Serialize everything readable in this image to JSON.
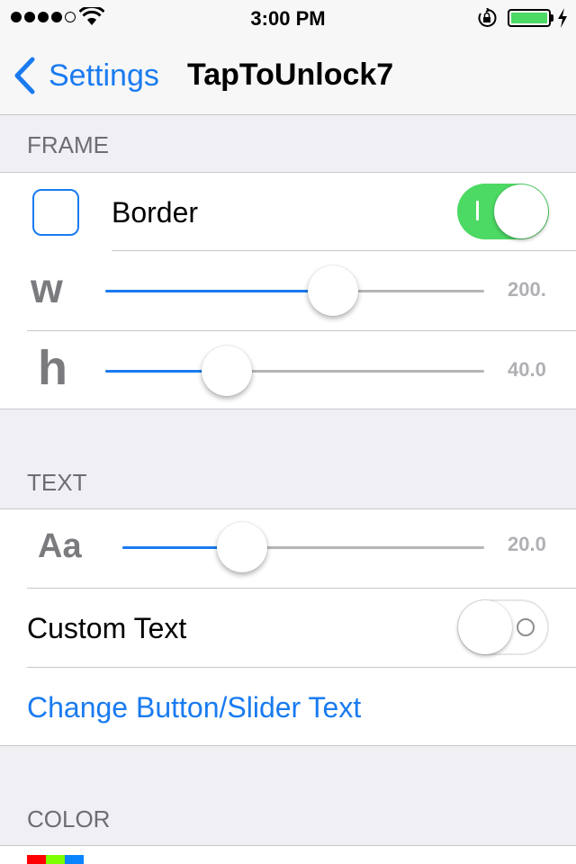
{
  "status_bar": {
    "time": "3:00 PM",
    "signal_bars": 5,
    "signal_filled": 4,
    "battery_level": 1.0,
    "battery_color": "#4cd964",
    "icons": [
      "signal-icon",
      "wifi-icon",
      "rotation-lock-icon",
      "battery-icon",
      "charging-icon"
    ]
  },
  "nav": {
    "back_label": "Settings",
    "title": "TapToUnlock7",
    "accent_color": "#1a7bf0"
  },
  "frame": {
    "header": "FRAME",
    "border_label": "Border",
    "border_enabled": true,
    "width": {
      "glyph": "w",
      "value_label": "200.",
      "level": 0.6
    },
    "height": {
      "glyph": "h",
      "value_label": "40.0",
      "level": 0.32
    }
  },
  "text": {
    "header": "TEXT",
    "size": {
      "glyph": "Aa",
      "value_label": "20.0",
      "level": 0.33
    },
    "custom_text_label": "Custom Text",
    "custom_text_enabled": false,
    "change_text_link": "Change Button/Slider Text"
  },
  "color": {
    "header": "COLOR",
    "swatches": [
      "#ff0000",
      "#7cff00",
      "#0a84ff"
    ]
  }
}
